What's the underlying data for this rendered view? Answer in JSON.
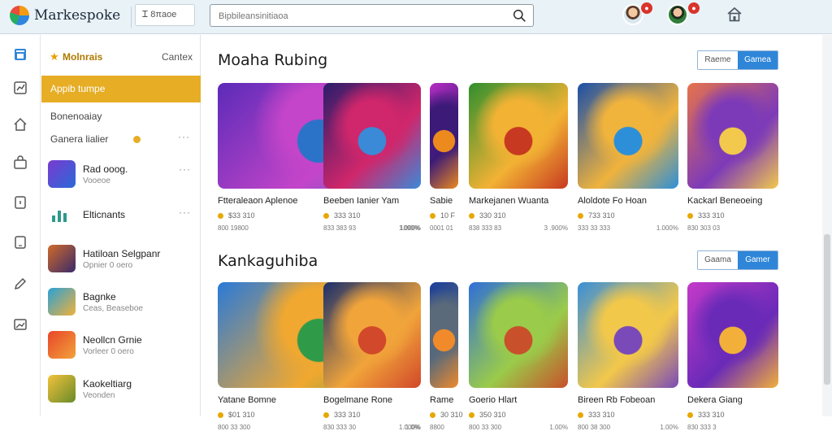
{
  "header": {
    "brand": "Markespoke",
    "filter_label": "Ꮖ 8πaoe",
    "search_placeholder": "Bipbileansinitiaoa",
    "notification_badge_1": "●",
    "notification_badge_2": "●"
  },
  "sidebar": {
    "title": "Molnrais",
    "cancel_label": "Cantex",
    "active_item": "Appib tumpe",
    "plain_item_1": "Bonenoaiay",
    "plain_item_2": "Ganera lialier",
    "more": "···",
    "apps": [
      {
        "name": "Rad ooog.",
        "sub": "Vooeoe"
      },
      {
        "name": "Elticnants",
        "sub": ""
      },
      {
        "name": "Hatiloan Selgpanr",
        "sub": "Opnier 0 oero"
      },
      {
        "name": "Bagnke",
        "sub": "Ceas, Beaseboe"
      },
      {
        "name": "Neollcn Grnie",
        "sub": "Vorleer 0 oero"
      },
      {
        "name": "Kaokeltiarg",
        "sub": "Veonden"
      }
    ]
  },
  "sections": [
    {
      "title": "Moaha Rubing",
      "toggle_off": "Raeme",
      "toggle_on": "Gamea",
      "cards": [
        {
          "name": "Ftteraleaon Aplenoe",
          "price": "$33 310",
          "meta_left": "800 19800",
          "meta_right": "1099%",
          "colors": [
            "#5b2bb8",
            "#c445c9",
            "#2a73c8"
          ]
        },
        {
          "name": "Beeben Ianier Yam",
          "price": "333 310",
          "meta_left": "833 383 93",
          "meta_right": "1.000%",
          "colors": [
            "#2b1d6b",
            "#d0266b",
            "#3a8ad8"
          ]
        },
        {
          "name": "Sabie",
          "price": "10 F",
          "meta_left": "0001 01",
          "meta_right": "",
          "colors": [
            "#b52cc2",
            "#3b1a78",
            "#ec8a1e"
          ]
        },
        {
          "name": "Markejanen Wuanta",
          "price": "330 310",
          "meta_left": "838 333 83",
          "meta_right": "3 .900%",
          "colors": [
            "#2e8f2e",
            "#f2b234",
            "#c73920"
          ]
        },
        {
          "name": "Aloldote Fo Hoan",
          "price": "733 310",
          "meta_left": "333 33 333",
          "meta_right": "1.000%",
          "colors": [
            "#1b4fa8",
            "#f0b33c",
            "#2d8fd8"
          ]
        },
        {
          "name": "Kackarl Beneoeing",
          "price": "333 310",
          "meta_left": "830 303 03",
          "meta_right": "",
          "colors": [
            "#e6734b",
            "#7d3ab8",
            "#f2c94c"
          ]
        }
      ]
    },
    {
      "title": "Kankaguhiba",
      "toggle_off": "Gaama",
      "toggle_on": "Gamer",
      "cards": [
        {
          "name": "Yatane Bomne",
          "price": "$01 310",
          "meta_left": "800 33 300",
          "meta_right": "1.0%",
          "colors": [
            "#2a7ad8",
            "#f0a830",
            "#2f9a48"
          ]
        },
        {
          "name": "Bogelmane Rone",
          "price": "333 310",
          "meta_left": "830 333 30",
          "meta_right": "1.000%",
          "colors": [
            "#1a2f6b",
            "#f1a43a",
            "#d1482a"
          ]
        },
        {
          "name": "Rame",
          "price": "30 310",
          "meta_left": "8800",
          "meta_right": "",
          "colors": [
            "#1c3f9a",
            "#5a6a7a",
            "#f08a2a"
          ]
        },
        {
          "name": "Goerio Hlart",
          "price": "350 310",
          "meta_left": "800 33 300",
          "meta_right": "1.00%",
          "colors": [
            "#2e6fd8",
            "#9acb4a",
            "#c8502a"
          ]
        },
        {
          "name": "Bireen Rb Fobeoan",
          "price": "333 310",
          "meta_left": "800 38 300",
          "meta_right": "1.00%",
          "colors": [
            "#3a8fd8",
            "#f2c84a",
            "#7a4ab8"
          ]
        },
        {
          "name": "Dekera Giang",
          "price": "333 310",
          "meta_left": "830 333 3",
          "meta_right": "",
          "colors": [
            "#c43ac8",
            "#6a2ab8",
            "#f2b03a"
          ]
        }
      ]
    }
  ]
}
